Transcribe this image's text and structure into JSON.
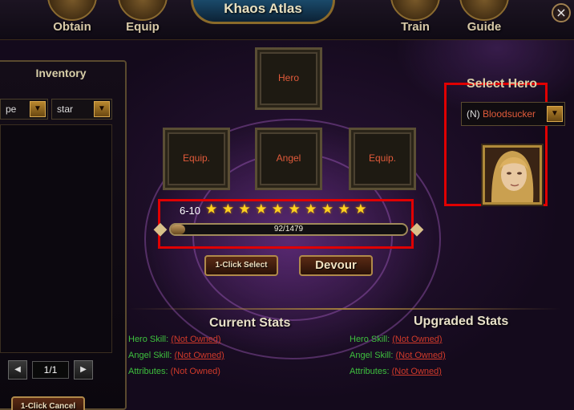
{
  "header": {
    "title": "Khaos Atlas",
    "nav": [
      {
        "label": "Obtain",
        "icon": "obtain-icon"
      },
      {
        "label": "Equip",
        "icon": "equip-icon"
      },
      {
        "label": "Train",
        "icon": "train-icon"
      },
      {
        "label": "Guide",
        "icon": "guide-icon"
      }
    ],
    "close_icon": "×"
  },
  "inventory": {
    "title": "Inventory",
    "filter_type": "pe",
    "filter_star": "star",
    "page": "1/1",
    "prev_icon": "◀",
    "next_icon": "▶",
    "cancel_label": "1-Click Cancel"
  },
  "slots": {
    "hero": "Hero",
    "equip_left": "Equip.",
    "angel": "Angel",
    "equip_right": "Equip."
  },
  "stars": {
    "range_label": "6-10",
    "count": 10,
    "star_glyph": "★"
  },
  "progress": {
    "current": 92,
    "max": 1479,
    "text": "92/1479"
  },
  "actions": {
    "one_click_select": "1-Click Select",
    "devour": "Devour"
  },
  "select_hero": {
    "title": "Select Hero",
    "prefix": "(N)",
    "name": "Bloodsucker"
  },
  "current_stats": {
    "title": "Current Stats",
    "hero_skill_key": "Hero Skill:",
    "hero_skill_val": "(Not Owned)",
    "angel_skill_key": "Angel Skill:",
    "angel_skill_val": "(Not Owned)",
    "attributes_key": "Attributes:",
    "attributes_val": "(Not Owned)"
  },
  "upgraded_stats": {
    "title": "Upgraded Stats",
    "hero_skill_key": "Hero Skill:",
    "hero_skill_val": "(Not Owned)",
    "angel_skill_key": "Angel Skill:",
    "angel_skill_val": "(Not Owned)",
    "attributes_key": "Attributes:",
    "attributes_val": "(Not Owned)"
  },
  "colors": {
    "highlight_box": "#e00000",
    "star": "#ffd21e",
    "stat_key": "#3ec03e",
    "stat_val": "#d03a2a",
    "hero_name": "#e05a3a"
  }
}
